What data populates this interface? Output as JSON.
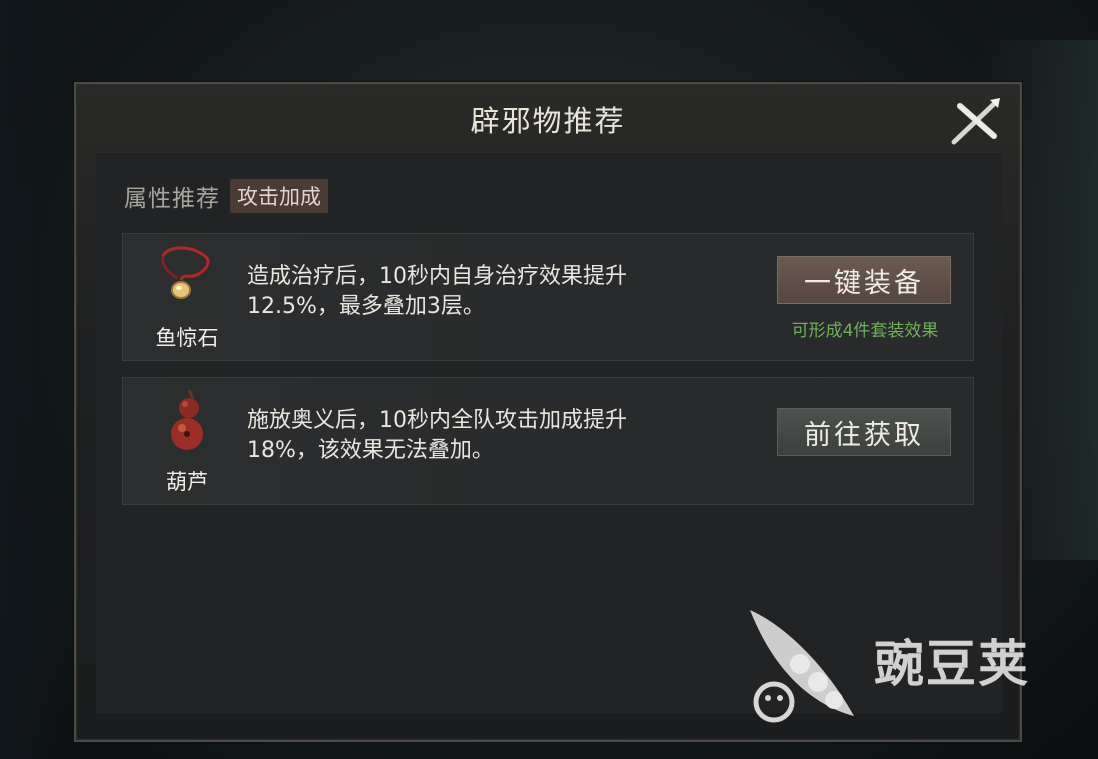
{
  "dialog": {
    "title": "辟邪物推荐",
    "close_icon": "close-x-icon"
  },
  "attribute": {
    "label": "属性推荐",
    "tag": "攻击加成"
  },
  "items": [
    {
      "icon": "necklace-stone-icon",
      "name": "鱼惊石",
      "description_line1": "造成治疗后，10秒内自身治疗效果提升",
      "description_line2": "12.5%，最多叠加3层。",
      "button_label": "一键装备",
      "note": "可形成4件套装效果"
    },
    {
      "icon": "gourd-icon",
      "name": "葫芦",
      "description_line1": "施放奥义后，10秒内全队攻击加成提升",
      "description_line2": "18%，该效果无法叠加。",
      "button_label": "前往获取"
    }
  ],
  "watermark": {
    "text": "豌豆荚",
    "icon": "pea-pod-logo-icon"
  },
  "colors": {
    "note_green": "#6fb05a",
    "equip_button": "#5f5048",
    "go_button": "#454a47",
    "attr_tag_bg": "#4a3b35"
  }
}
